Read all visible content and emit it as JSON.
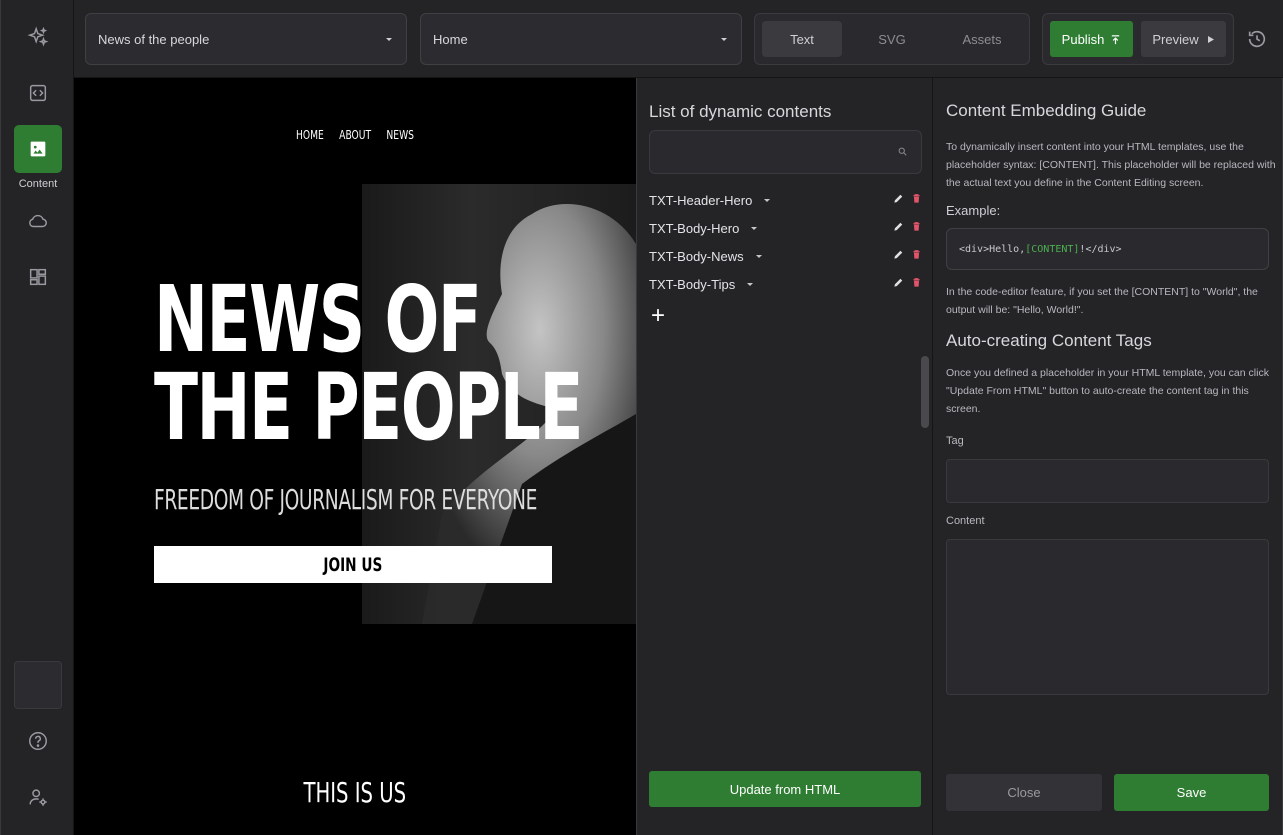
{
  "rail": {
    "items": [
      {
        "icon": "sparkles-icon"
      },
      {
        "icon": "code-icon"
      },
      {
        "icon": "image-icon",
        "label": "Content",
        "active": true
      },
      {
        "icon": "cloud-icon"
      },
      {
        "icon": "dashboard-icon"
      },
      {
        "icon": "help-icon"
      },
      {
        "icon": "user-settings-icon"
      }
    ]
  },
  "topbar": {
    "project_select": "News of the people",
    "page_select": "Home",
    "tabs": [
      {
        "label": "Text",
        "active": true
      },
      {
        "label": "SVG",
        "active": false
      },
      {
        "label": "Assets",
        "active": false
      }
    ],
    "publish_label": "Publish",
    "preview_label": "Preview"
  },
  "canvas": {
    "nav": [
      "HOME",
      "ABOUT",
      "NEWS"
    ],
    "hero_title_line1": "NEWS OF",
    "hero_title_line2": "THE PEOPLE",
    "hero_subtitle": "FREEDOM OF JOURNALISM FOR EVERYONE",
    "join_label": "JOIN US",
    "section_title": "THIS IS US"
  },
  "content_list": {
    "title": "List of dynamic contents",
    "search_placeholder": "",
    "items": [
      {
        "label": "TXT-Header-Hero"
      },
      {
        "label": "TXT-Body-Hero"
      },
      {
        "label": "TXT-Body-News"
      },
      {
        "label": "TXT-Body-Tips"
      }
    ],
    "add_symbol": "+",
    "update_label": "Update from HTML"
  },
  "guide": {
    "title": "Content Embedding Guide",
    "intro": "To dynamically insert content into your HTML templates, use the placeholder syntax: [CONTENT]. This placeholder will be replaced with the actual text you define in the Content Editing screen.",
    "example_label": "Example:",
    "code_before": "<div>Hello, ",
    "code_placeholder": "[CONTENT]",
    "code_after": "!</div>",
    "example_note": "In the code-editor feature, if you set the [CONTENT] to \"World\", the output will be: \"Hello, World!\".",
    "auto_title": "Auto-creating Content Tags",
    "auto_text": "Once you defined a placeholder in your HTML template, you can click \"Update From HTML\" button to auto-create the content tag in this screen.",
    "tag_label": "Tag",
    "tag_value": "",
    "content_label": "Content",
    "content_value": "",
    "close_label": "Close",
    "save_label": "Save"
  },
  "colors": {
    "accent": "#2e7d32",
    "delete": "#e0556a"
  }
}
